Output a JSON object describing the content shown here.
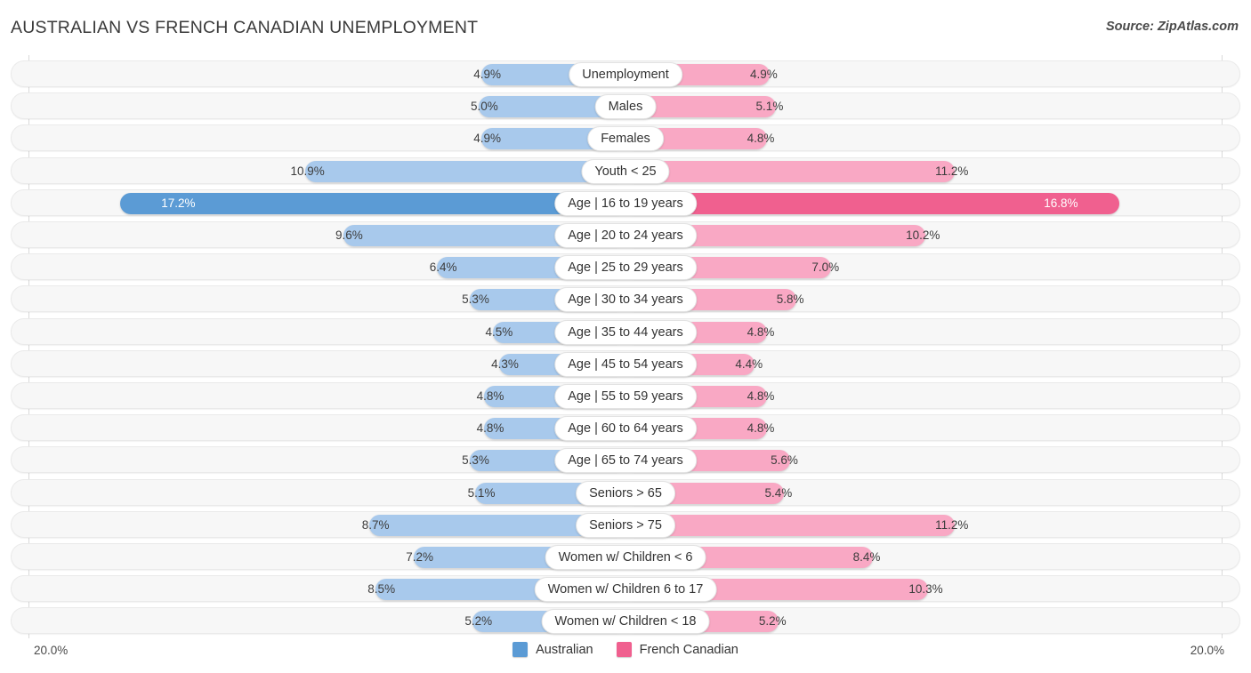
{
  "header": {
    "title": "AUSTRALIAN VS FRENCH CANADIAN UNEMPLOYMENT",
    "source": "Source: ZipAtlas.com"
  },
  "axis": {
    "left_tick": "20.0%",
    "right_tick": "20.0%",
    "max": 20.0
  },
  "legend": {
    "items": [
      {
        "label": "Australian",
        "color": "#5b9bd5"
      },
      {
        "label": "French Canadian",
        "color": "#f0608f"
      }
    ]
  },
  "colors": {
    "australian_light": "#a8c9ec",
    "australian_dark": "#5b9bd5",
    "french_light": "#f9a8c4",
    "french_dark": "#f0608f",
    "track": "#f7f7f7",
    "text": "#3d3d3d"
  },
  "chart_data": {
    "type": "bar",
    "subtype": "diverging-bidirectional",
    "title": "AUSTRALIAN VS FRENCH CANADIAN UNEMPLOYMENT",
    "xlabel": "",
    "ylabel": "",
    "xlim": [
      20.0,
      20.0
    ],
    "grid": false,
    "legend_position": "bottom-center",
    "categories": [
      "Unemployment",
      "Males",
      "Females",
      "Youth < 25",
      "Age | 16 to 19 years",
      "Age | 20 to 24 years",
      "Age | 25 to 29 years",
      "Age | 30 to 34 years",
      "Age | 35 to 44 years",
      "Age | 45 to 54 years",
      "Age | 55 to 59 years",
      "Age | 60 to 64 years",
      "Age | 65 to 74 years",
      "Seniors > 65",
      "Seniors > 75",
      "Women w/ Children < 6",
      "Women w/ Children 6 to 17",
      "Women w/ Children < 18"
    ],
    "series": [
      {
        "name": "Australian",
        "side": "left",
        "values": [
          4.9,
          5.0,
          4.9,
          10.9,
          17.2,
          9.6,
          6.4,
          5.3,
          4.5,
          4.3,
          4.8,
          4.8,
          5.3,
          5.1,
          8.7,
          7.2,
          8.5,
          5.2
        ],
        "labels": [
          "4.9%",
          "5.0%",
          "4.9%",
          "10.9%",
          "17.2%",
          "9.6%",
          "6.4%",
          "5.3%",
          "4.5%",
          "4.3%",
          "4.8%",
          "4.8%",
          "5.3%",
          "5.1%",
          "8.7%",
          "7.2%",
          "8.5%",
          "5.2%"
        ]
      },
      {
        "name": "French Canadian",
        "side": "right",
        "values": [
          4.9,
          5.1,
          4.8,
          11.2,
          16.8,
          10.2,
          7.0,
          5.8,
          4.8,
          4.4,
          4.8,
          4.8,
          5.6,
          5.4,
          11.2,
          8.4,
          10.3,
          5.2
        ],
        "labels": [
          "4.9%",
          "5.1%",
          "4.8%",
          "11.2%",
          "16.8%",
          "10.2%",
          "7.0%",
          "5.8%",
          "4.8%",
          "4.4%",
          "4.8%",
          "4.8%",
          "5.6%",
          "5.4%",
          "11.2%",
          "8.4%",
          "10.3%",
          "5.2%"
        ]
      }
    ]
  }
}
